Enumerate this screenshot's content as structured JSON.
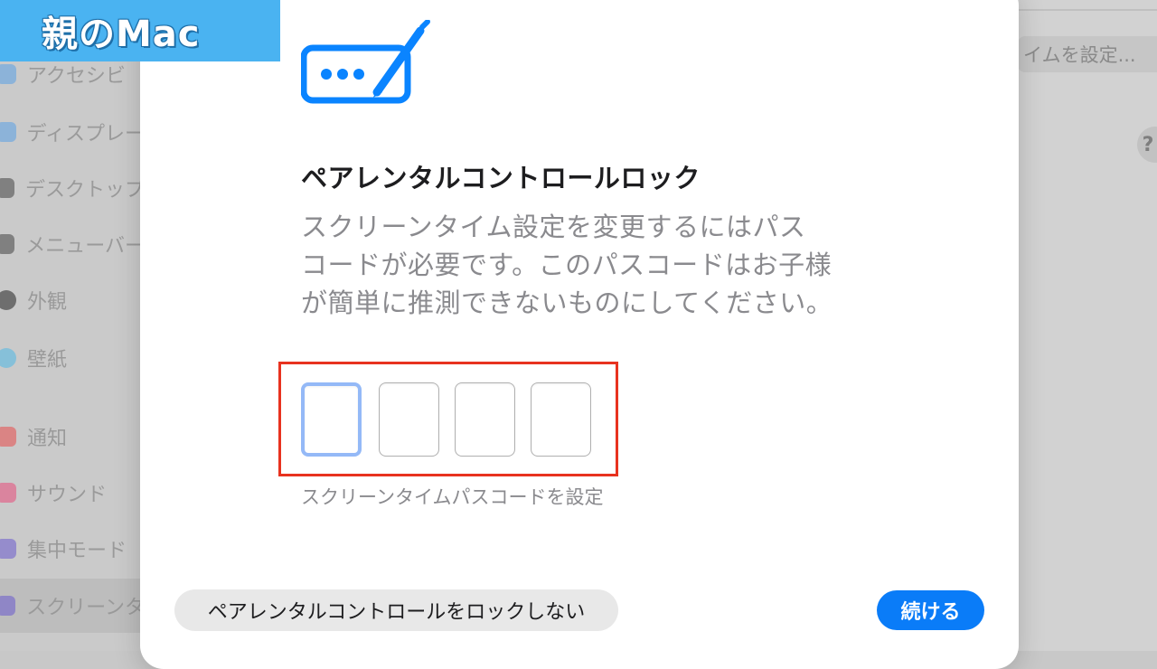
{
  "badge": {
    "text": "親のMac"
  },
  "background": {
    "sidebar_items": [
      {
        "label": "アクセシビ",
        "icon": "accessibility-icon",
        "color": "#5aa0e6"
      },
      {
        "label": "ディスプレー",
        "icon": "display-icon",
        "color": "#5aa0e6"
      },
      {
        "label": "デスクトップ",
        "icon": "desktop-dock-icon",
        "color": "#444444"
      },
      {
        "label": "メニューバー",
        "icon": "menubar-icon",
        "color": "#444444"
      },
      {
        "label": "外観",
        "icon": "appearance-icon",
        "color": "#222222"
      },
      {
        "label": "壁紙",
        "icon": "wallpaper-icon",
        "color": "#4fb8e6"
      },
      {
        "label": "通知",
        "icon": "notifications-icon",
        "color": "#e84a4a"
      },
      {
        "label": "サウンド",
        "icon": "sound-icon",
        "color": "#e84a7a"
      },
      {
        "label": "集中モード",
        "icon": "focus-icon",
        "color": "#6a5acd"
      },
      {
        "label": "スクリーンタ",
        "icon": "screen-time-icon",
        "color": "#6a5acd"
      }
    ],
    "right_button": "イムを設定...",
    "help": "?"
  },
  "dialog": {
    "title": "ペアレンタルコントロールロック",
    "description_lines": [
      "スクリーンタイム設定を変更するにはパス",
      "コードが必要です。このパスコードはお子様",
      "が簡単に推測できないものにしてください。"
    ],
    "passcode_caption": "スクリーンタイムパスコードを設定",
    "digits": 4,
    "secondary_button": "ペアレンタルコントロールをロックしない",
    "primary_button": "続ける"
  },
  "colors": {
    "accent": "#0a7cf8",
    "highlight": "#e8321f",
    "badge": "#4ab3f1"
  }
}
